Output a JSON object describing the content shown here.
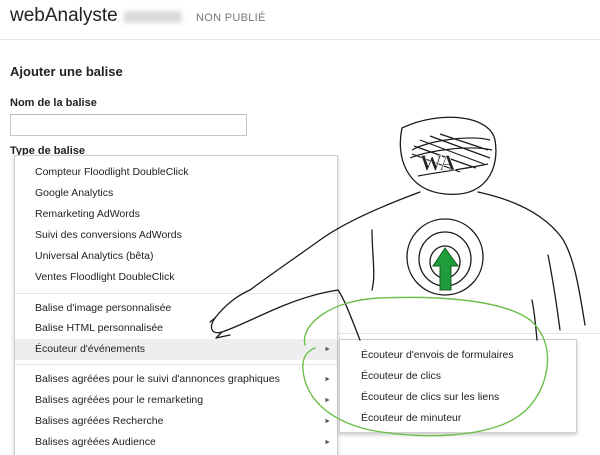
{
  "header": {
    "app_title": "webAnalyste",
    "status": "NON PUBLIÉ"
  },
  "form": {
    "heading": "Ajouter une balise",
    "name_label": "Nom de la balise",
    "name_value": "",
    "type_label": "Type de balise"
  },
  "menu": {
    "group1": [
      "Compteur Floodlight DoubleClick",
      "Google Analytics",
      "Remarketing AdWords",
      "Suivi des conversions AdWords",
      "Universal Analytics (bêta)",
      "Ventes Floodlight DoubleClick"
    ],
    "group2": [
      "Balise d'image personnalisée",
      "Balise HTML personnalisée",
      "Écouteur d'événements"
    ],
    "group3": [
      "Balises agréées pour le suivi d'annonces graphiques",
      "Balises agréées pour le remarketing",
      "Balises agréées Recherche",
      "Balises agréées Audience"
    ]
  },
  "submenu": {
    "items": [
      "Écouteur d'envois de formulaires",
      "Écouteur de clics",
      "Écouteur de clics sur les liens",
      "Écouteur de minuteur"
    ]
  },
  "drawing": {
    "logo_text": "WA",
    "highlight_color": "#6cc04a",
    "arrow_color": "#1f9d3a"
  },
  "colors": {
    "active_item_bg": "#eeeeee",
    "border": "#cfcfcf"
  }
}
